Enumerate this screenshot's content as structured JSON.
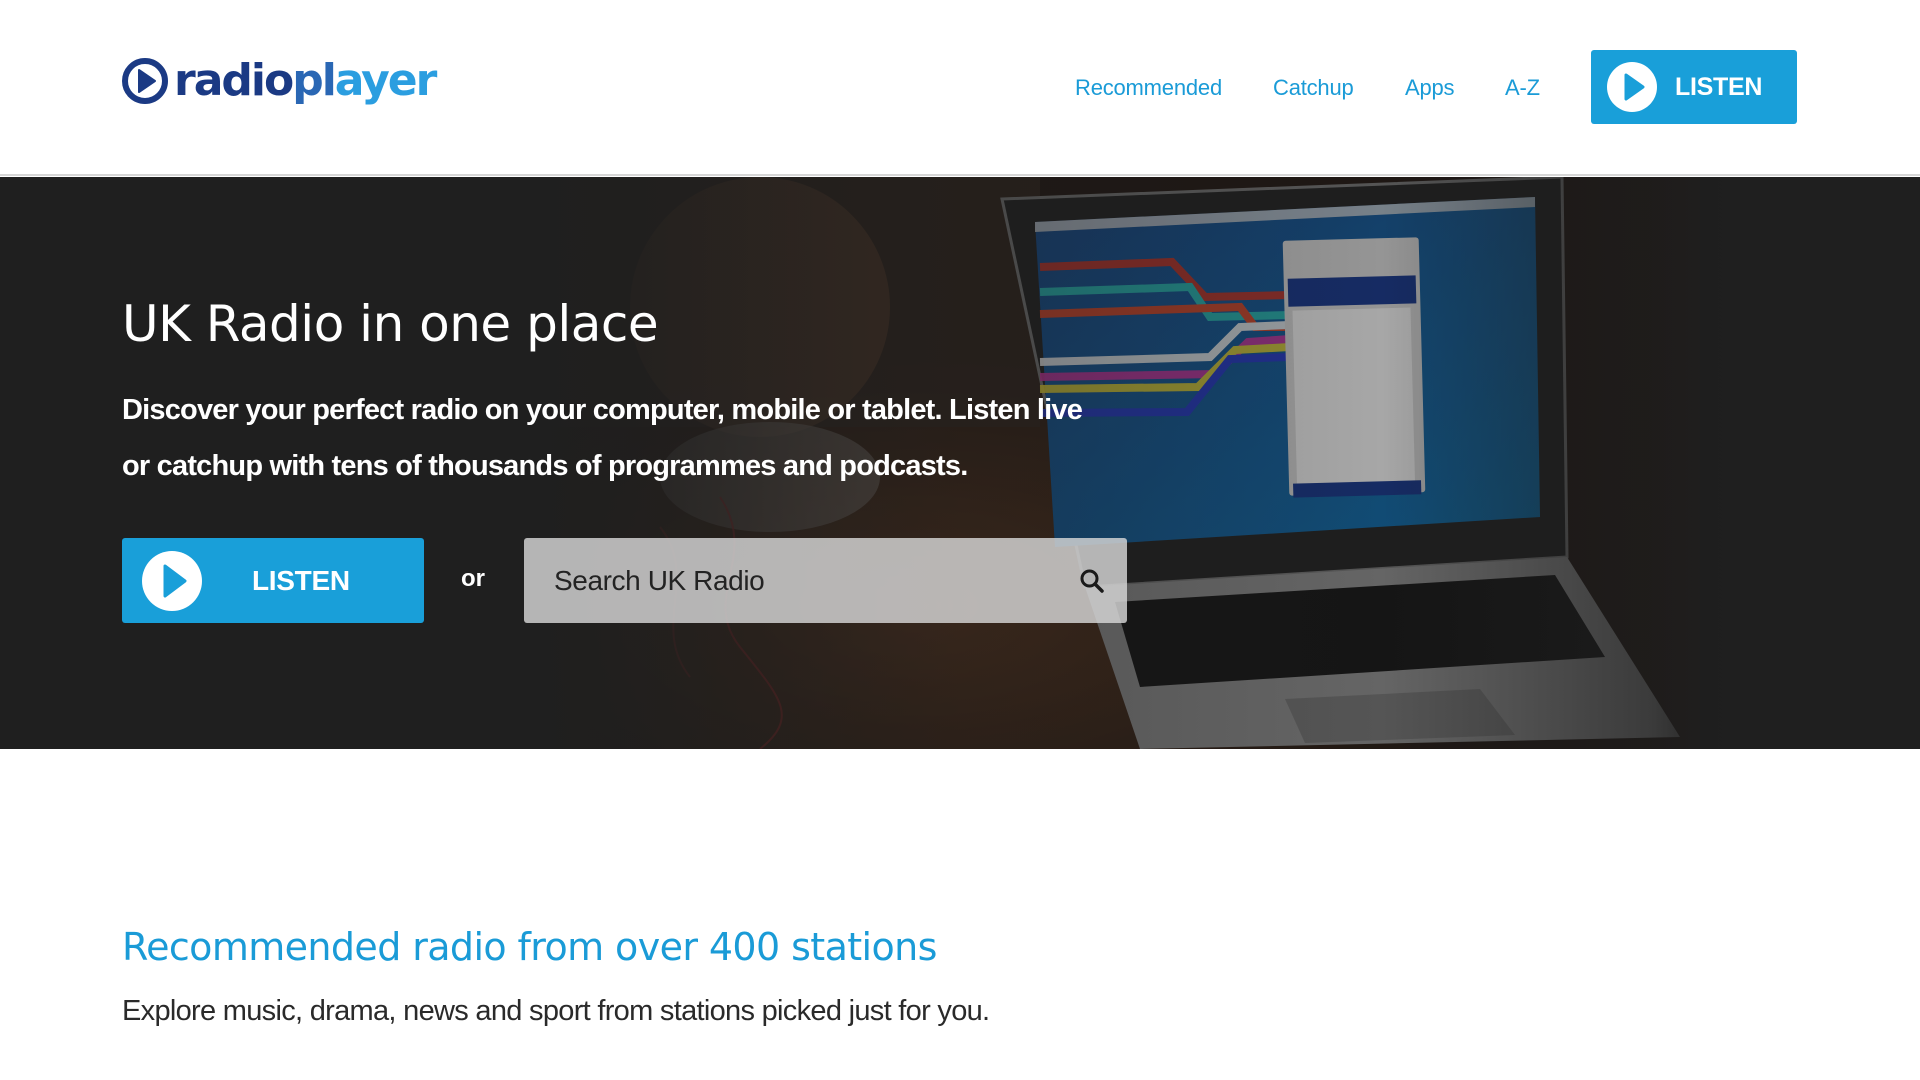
{
  "header": {
    "logo_text": [
      "radio",
      "pl",
      "ayer"
    ],
    "logo_alt": "radioplayer",
    "nav": [
      {
        "label": "Recommended"
      },
      {
        "label": "Catchup"
      },
      {
        "label": "Apps"
      },
      {
        "label": "A-Z"
      }
    ],
    "listen_label": "LISTEN"
  },
  "hero": {
    "title": "UK Radio in one place",
    "description_line1": "Discover your perfect radio on your computer, mobile or tablet. Listen live",
    "description_line2": "or catchup with tens of thousands of programmes and podcasts.",
    "listen_label": "LISTEN",
    "or_label": "or",
    "search_placeholder": "Search UK Radio",
    "search_value": "",
    "background_image": "laptop-showing-radioplayer-app"
  },
  "recommended": {
    "title": "Recommended radio from over 400 stations",
    "subtitle": "Explore music, drama, news and sport from stations picked just for you."
  },
  "colors": {
    "brand_blue": "#199fd9",
    "brand_navy": "#1b3a84",
    "link_blue": "#1a9bd7",
    "hero_bg": "#1f1f1f"
  }
}
